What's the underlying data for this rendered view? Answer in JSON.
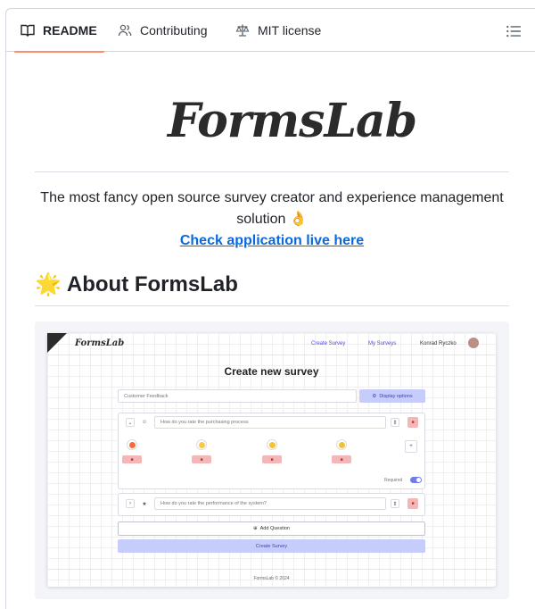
{
  "tabs": [
    {
      "label": "README",
      "icon": "book-icon",
      "active": true
    },
    {
      "label": "Contributing",
      "icon": "people-icon",
      "active": false
    },
    {
      "label": "MIT license",
      "icon": "scale-icon",
      "active": false
    }
  ],
  "toc_icon": "list-unordered-icon",
  "readme": {
    "logo_text": "FormsLab",
    "description": "The most fancy open source survey creator and experience management solution 👌",
    "live_link": "Check application live here",
    "about_heading": "About FormsLab",
    "about_emoji": "🌟"
  },
  "screenshot": {
    "logo": "FormsLab",
    "nav": [
      "Create Survey",
      "My Surveys"
    ],
    "user": "Konrad Ryczko",
    "title": "Create new survey",
    "survey_name_placeholder": "Customer Feedback",
    "display_options": "Display options",
    "question_1": "How do you rate the purchasing process",
    "question_2": "How do you rate the performance of the system?",
    "required_label": "Required",
    "add_question": "Add Question",
    "create_survey": "Create Survey",
    "footer": "FormsLab © 2024",
    "smiley_colors": [
      "#f26b3a",
      "#f7c948",
      "#f4c430",
      "#f1c232"
    ]
  },
  "colors": {
    "active_tab_underline": "#fd8c73",
    "link": "#0969da"
  }
}
